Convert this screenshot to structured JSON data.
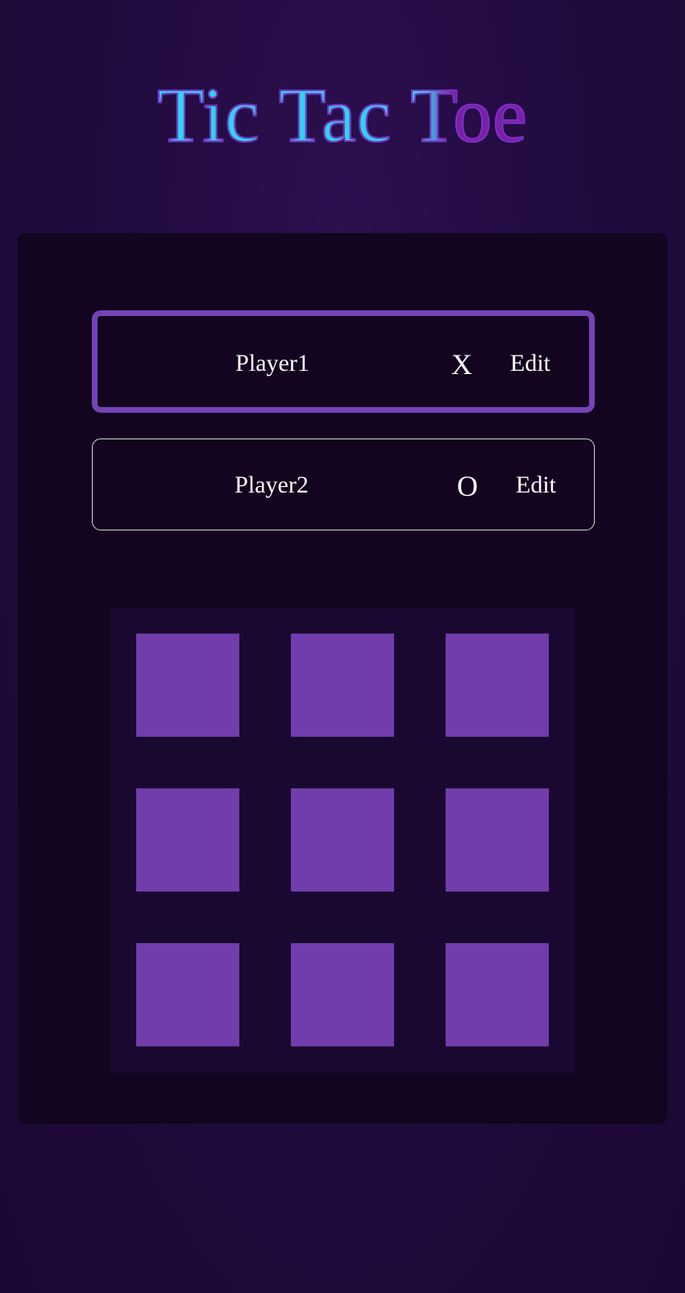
{
  "title": "Tic Tac Toe",
  "colors": {
    "background": "#220b40",
    "panel": "#13041f",
    "board": "#1a0831",
    "cell": "#713dac",
    "active_border": "#7543b8",
    "title_fill": "#2ed3f0",
    "title_accent": "#7a1fa8"
  },
  "players": [
    {
      "name": "Player1",
      "symbol": "X",
      "edit_label": "Edit",
      "active": true
    },
    {
      "name": "Player2",
      "symbol": "O",
      "edit_label": "Edit",
      "active": false
    }
  ],
  "board": {
    "cells": [
      "",
      "",
      "",
      "",
      "",
      "",
      "",
      "",
      ""
    ]
  }
}
